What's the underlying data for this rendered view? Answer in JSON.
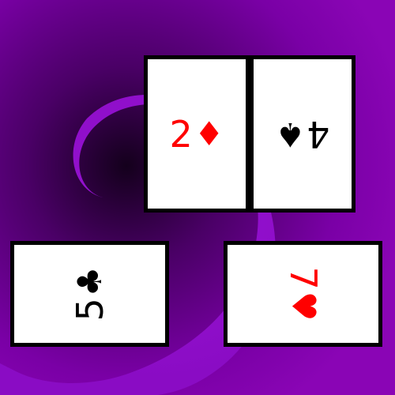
{
  "background": {
    "base_color": "#7d00a8",
    "dark_color": "#1a0020",
    "swirl_color": "#8a10c8"
  },
  "cards": [
    {
      "name": "card-2-diamonds",
      "rank": "2",
      "suit": "♦",
      "suit_name": "diamonds",
      "color": "red"
    },
    {
      "name": "card-4-spades",
      "rank": "4",
      "suit": "♠",
      "suit_name": "spades",
      "color": "black"
    },
    {
      "name": "card-5-clubs",
      "rank": "5",
      "suit": "♣",
      "suit_name": "clubs",
      "color": "black"
    },
    {
      "name": "card-7-hearts",
      "rank": "7",
      "suit": "♥",
      "suit_name": "hearts",
      "color": "red"
    }
  ]
}
